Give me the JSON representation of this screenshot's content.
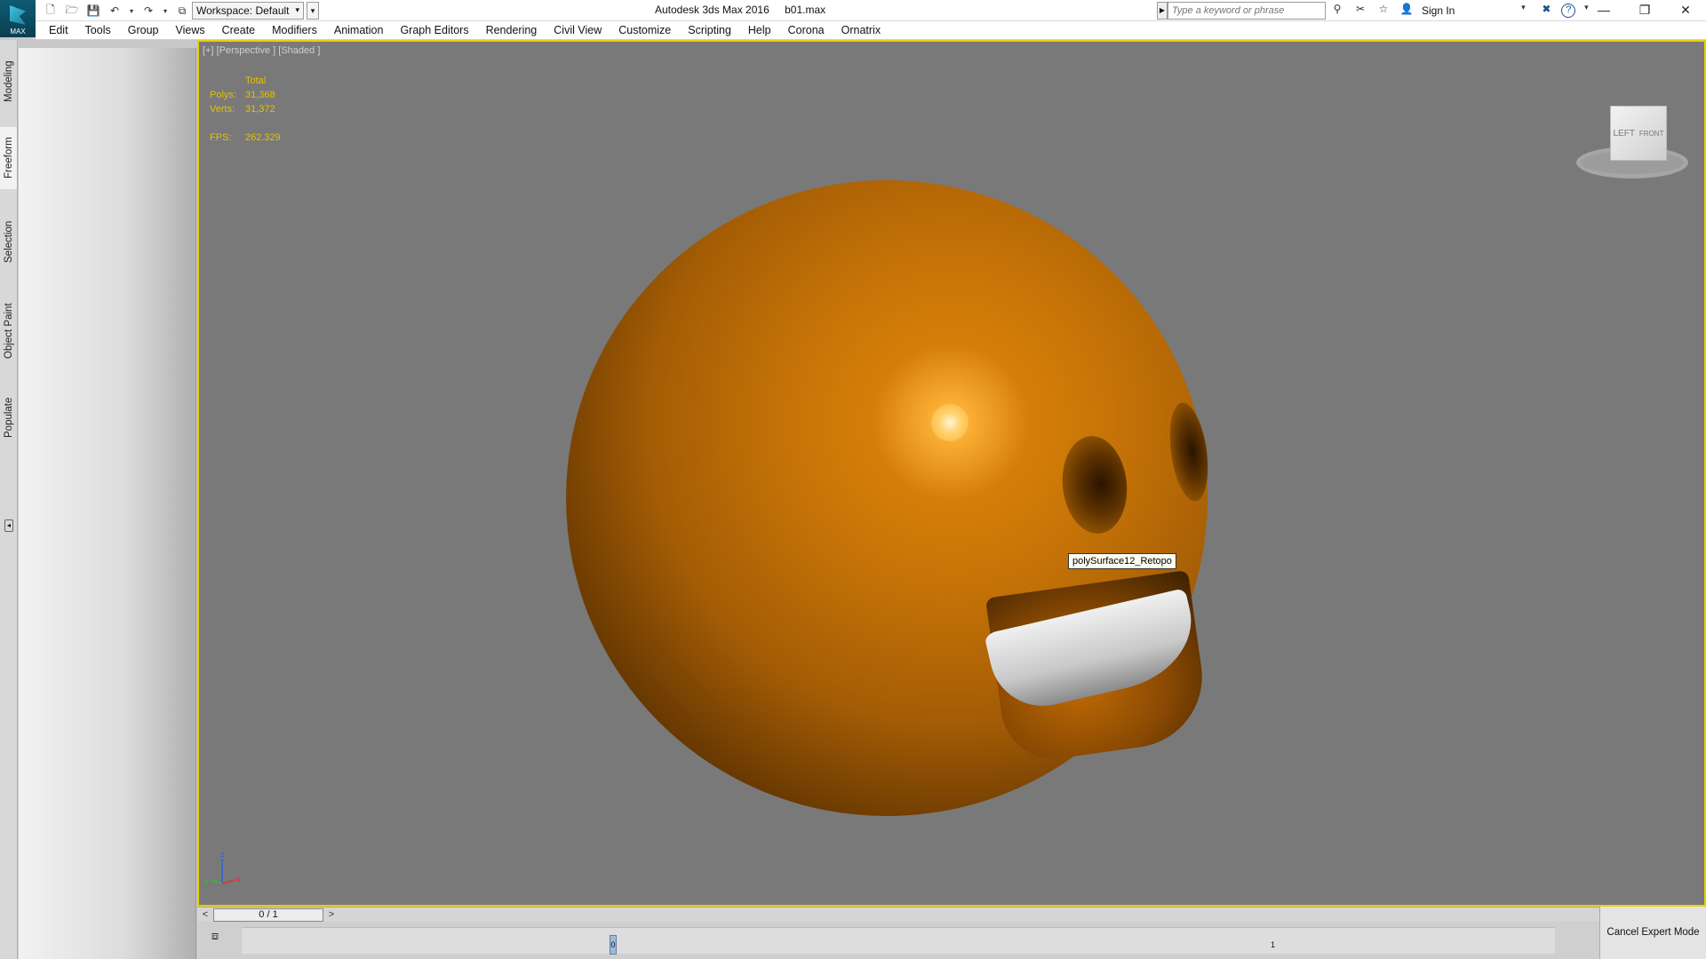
{
  "titlebar": {
    "app_name": "Autodesk 3ds Max 2016",
    "file_name": "b01.max",
    "logo_label": "MAX",
    "workspace": "Workspace: Default",
    "search_placeholder": "Type a keyword or phrase",
    "sign_in": "Sign In",
    "help_icon": "?"
  },
  "menu": [
    "Edit",
    "Tools",
    "Group",
    "Views",
    "Create",
    "Modifiers",
    "Animation",
    "Graph Editors",
    "Rendering",
    "Civil View",
    "Customize",
    "Scripting",
    "Help",
    "Corona",
    "Ornatrix"
  ],
  "ribbon_tabs": [
    "Modeling",
    "Freeform",
    "Selection",
    "Object Paint",
    "Populate"
  ],
  "active_ribbon_tab": "Freeform",
  "viewport": {
    "label": "[+] [Perspective ] [Shaded ]",
    "stats": {
      "header": "Total",
      "polys_label": "Polys:",
      "polys": "31,368",
      "verts_label": "Verts:",
      "verts": "31,372",
      "fps_label": "FPS:",
      "fps": "262.329"
    },
    "tooltip": "polySurface12_Retopo",
    "viewcube_left": "LEFT",
    "viewcube_front": "FRONT",
    "object_color": "#c97608",
    "background_color": "#797979",
    "active_border_color": "#e6d100"
  },
  "timeline": {
    "frame": "0 / 1",
    "prev": "<",
    "next": ">",
    "key_start": "0",
    "key_end": "1"
  },
  "cancel_expert_mode": "Cancel Expert Mode"
}
